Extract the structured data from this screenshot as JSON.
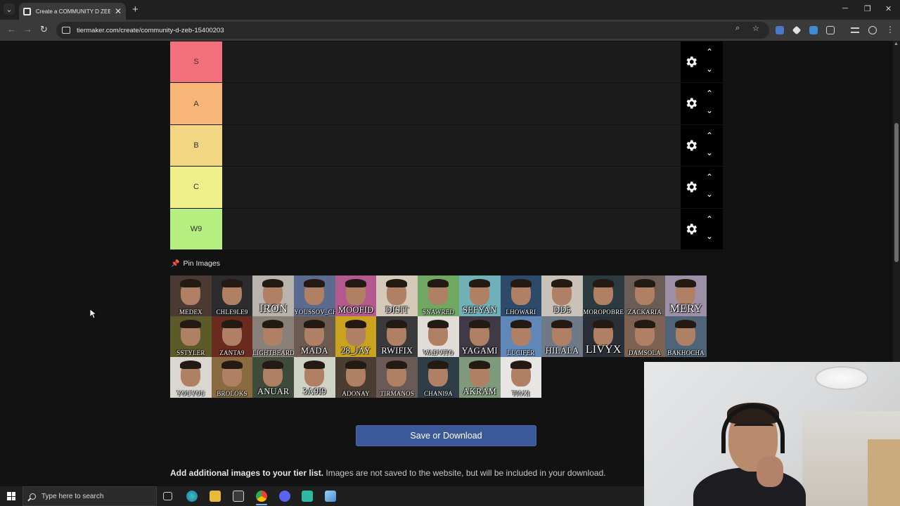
{
  "browser": {
    "tab_title": "Create a COMMUNITY D ZEB Tier List",
    "tab_close": "✕",
    "new_tab": "+",
    "url": "tiermaker.com/create/community-d-zeb-15400203",
    "window_controls": {
      "minimize": "─",
      "restore": "❐",
      "close": "✕"
    },
    "nav": {
      "back": "←",
      "forward": "→",
      "reload": "↻"
    }
  },
  "tiers": [
    {
      "label": "S",
      "color": "#f2707b"
    },
    {
      "label": "A",
      "color": "#f7b677"
    },
    {
      "label": "B",
      "color": "#f3d682"
    },
    {
      "label": "C",
      "color": "#f0f08a"
    },
    {
      "label": "W9",
      "color": "#b6ee80"
    }
  ],
  "tier_controls": {
    "up": "⌃",
    "down": "⌄",
    "settings_icon": "gear-icon"
  },
  "pin": {
    "label": "Pin Images",
    "icon": "pushpin-icon"
  },
  "images": [
    {
      "name": "MEDEX",
      "size": "sm",
      "bg": "#4a3a33"
    },
    {
      "name": "CHLE9LE9",
      "size": "sm",
      "bg": "#2c2c2e"
    },
    {
      "name": "IRON",
      "size": "lg",
      "bg": "#b9b3ad"
    },
    {
      "name": "YOUSSOV_CH",
      "size": "sm",
      "bg": "#5b6a8f"
    },
    {
      "name": "MOOFID",
      "size": "md",
      "bg": "#b3598e"
    },
    {
      "name": "DISIT",
      "size": "md",
      "bg": "#d5c9ba"
    },
    {
      "name": "SNAWRED",
      "size": "sm",
      "bg": "#6fa860"
    },
    {
      "name": "SEFYAN",
      "size": "md",
      "bg": "#6fb0b9"
    },
    {
      "name": "LHOWARI",
      "size": "sm",
      "bg": "#2d4a6a"
    },
    {
      "name": "DD5",
      "size": "md",
      "bg": "#c9c2b8"
    },
    {
      "name": "MOROPOBRE",
      "size": "sm",
      "bg": "#2b3a3e"
    },
    {
      "name": "ZACKARIA",
      "size": "sm",
      "bg": "#6a5d55"
    },
    {
      "name": "MERY",
      "size": "lg",
      "bg": "#9c8fa6"
    },
    {
      "name": "SSTYLER",
      "size": "sm",
      "bg": "#5d5a2a"
    },
    {
      "name": "ZANTA9",
      "size": "sm",
      "bg": "#6b2a1e"
    },
    {
      "name": "LIGHTBEARD",
      "size": "sm",
      "bg": "#8a807a"
    },
    {
      "name": "MADA",
      "size": "md",
      "bg": "#6a5a50"
    },
    {
      "name": "28_JAY",
      "size": "md",
      "bg": "#c9a21e"
    },
    {
      "name": "RWIFIX",
      "size": "md",
      "bg": "#3a3a3c"
    },
    {
      "name": "WADVITO",
      "size": "sm",
      "bg": "#e1ddd6"
    },
    {
      "name": "YAGAMI",
      "size": "md",
      "bg": "#3f3a45"
    },
    {
      "name": "LUCIFER",
      "size": "sm",
      "bg": "#6187b8"
    },
    {
      "name": "HILALA",
      "size": "md",
      "bg": "#6e7a88"
    },
    {
      "name": "LIVYX",
      "size": "lg",
      "bg": "#2a2e36"
    },
    {
      "name": "DAMSOLA",
      "size": "sm",
      "bg": "#7d6253"
    },
    {
      "name": "BAKHOCHA",
      "size": "sm",
      "bg": "#4f6478"
    },
    {
      "name": "YOUYOU",
      "size": "sm",
      "bg": "#dad6d0"
    },
    {
      "name": "BROLOKS",
      "size": "sm",
      "bg": "#8a6a40"
    },
    {
      "name": "ANUAR",
      "size": "md",
      "bg": "#3e4a3a"
    },
    {
      "name": "3A9I9",
      "size": "md",
      "bg": "#cfd2c6"
    },
    {
      "name": "ADONAY",
      "size": "sm",
      "bg": "#4a3e33"
    },
    {
      "name": "TIRMANOS",
      "size": "sm",
      "bg": "#6a5a55"
    },
    {
      "name": "CHANI9A",
      "size": "sm",
      "bg": "#2f3d47"
    },
    {
      "name": "AKRAM",
      "size": "md",
      "bg": "#7f9a7a"
    },
    {
      "name": "TIOXI",
      "size": "sm",
      "bg": "#e8e6e4"
    }
  ],
  "save_button": "Save or Download",
  "add_images": {
    "bold": "Add additional images to your tier list.",
    "rest": " Images are not saved to the website, but will be included in your download."
  },
  "taskbar": {
    "search_placeholder": "Type here to search"
  }
}
